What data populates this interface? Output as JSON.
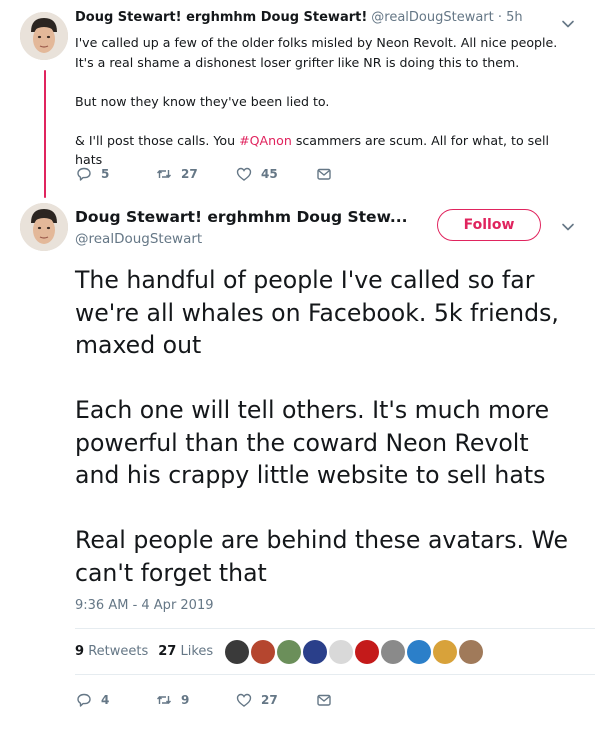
{
  "tweet1": {
    "name": "Doug Stewart! erghmhm Doug Stewart!",
    "handle": "@realDougStewart · 5h",
    "paragraph1": "I've called up a few of the older folks misled by Neon Revolt. All nice people. It's a real shame a dishonest loser grifter like NR is doing this to them.",
    "paragraph2": "But now they know they've been lied to.",
    "paragraph3_before": "& I'll post those calls. You ",
    "hashtag": "#QAnon",
    "paragraph3_after": " scammers are scum. All for what, to sell hats",
    "reply_count": "5",
    "retweet_count": "27",
    "like_count": "45"
  },
  "tweet2": {
    "name": "Doug Stewart! erghmhm Doug Stew...",
    "handle": "@realDougStewart",
    "follow_label": "Follow",
    "paragraph1": "The handful of people I've called so far we're all whales on Facebook. 5k friends, maxed out",
    "paragraph2": "Each one will tell others. It's much more powerful than the coward Neon Revolt and his crappy little website to sell hats",
    "paragraph3": "Real people are behind these avatars. We can't forget that",
    "timestamp": "9:36 AM - 4 Apr 2019",
    "retweets_count": "9",
    "retweets_label": "Retweets",
    "likes_count": "27",
    "likes_label": "Likes",
    "reply_count": "4",
    "retweet_count": "9",
    "like_count": "27"
  },
  "colors": {
    "accent": "#e0245e",
    "secondary_text": "#657786",
    "primary_text": "#14171a",
    "divider": "#e6ecf0"
  },
  "icons": [
    "reply-icon",
    "retweet-icon",
    "like-icon",
    "message-icon",
    "chevron-down-icon"
  ],
  "liker_colors": [
    "#3a3a3a",
    "#b5462f",
    "#6b8f5a",
    "#2a3f8a",
    "#d9d9d9",
    "#c41a1a",
    "#8a8a8a",
    "#2b7fc9",
    "#d8a23a",
    "#a07a5a"
  ]
}
